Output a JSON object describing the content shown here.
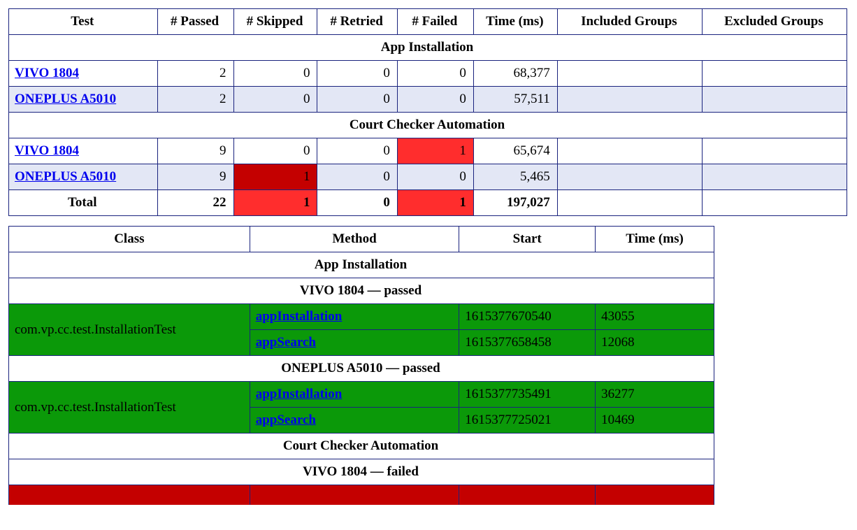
{
  "summary": {
    "headers": [
      "Test",
      "# Passed",
      "# Skipped",
      "# Retried",
      "# Failed",
      "Time (ms)",
      "Included Groups",
      "Excluded Groups"
    ],
    "sections": [
      {
        "title": "App Installation",
        "rows": [
          {
            "name": "VIVO 1804",
            "alt": false,
            "link": true,
            "cells": [
              "2",
              "0",
              "0",
              "0",
              "68,377",
              "",
              ""
            ],
            "flags": [
              null,
              null,
              null,
              null,
              null,
              null,
              null
            ]
          },
          {
            "name": "ONEPLUS A5010",
            "alt": true,
            "link": true,
            "cells": [
              "2",
              "0",
              "0",
              "0",
              "57,511",
              "",
              ""
            ],
            "flags": [
              null,
              null,
              null,
              null,
              null,
              null,
              null
            ]
          }
        ]
      },
      {
        "title": "Court Checker Automation",
        "rows": [
          {
            "name": "VIVO 1804",
            "alt": false,
            "link": true,
            "cells": [
              "9",
              "0",
              "0",
              "1",
              "65,674",
              "",
              ""
            ],
            "flags": [
              null,
              null,
              null,
              "danger2",
              null,
              null,
              null
            ]
          },
          {
            "name": "ONEPLUS A5010",
            "alt": true,
            "link": true,
            "cells": [
              "9",
              "1",
              "0",
              "0",
              "5,465",
              "",
              ""
            ],
            "flags": [
              null,
              "danger1",
              null,
              null,
              null,
              null,
              null
            ]
          }
        ]
      }
    ],
    "total": {
      "label": "Total",
      "cells": [
        "22",
        "1",
        "0",
        "1",
        "197,027",
        "",
        ""
      ],
      "flags": [
        null,
        "danger2",
        null,
        "danger2",
        null,
        null,
        null
      ]
    }
  },
  "details": {
    "headers": [
      "Class",
      "Method",
      "Start",
      "Time (ms)"
    ],
    "sections": [
      {
        "title": "App Installation",
        "devices": [
          {
            "heading": "VIVO 1804 — passed",
            "class": "com.vp.cc.test.InstallationTest",
            "rows": [
              {
                "method": "appInstallation",
                "start": "1615377670540",
                "time": "43055"
              },
              {
                "method": "appSearch",
                "start": "1615377658458",
                "time": "12068"
              }
            ]
          },
          {
            "heading": "ONEPLUS A5010 — passed",
            "class": "com.vp.cc.test.InstallationTest",
            "rows": [
              {
                "method": "appInstallation",
                "start": "1615377735491",
                "time": "36277"
              },
              {
                "method": "appSearch",
                "start": "1615377725021",
                "time": "10469"
              }
            ]
          }
        ]
      },
      {
        "title": "Court Checker Automation",
        "devices": [
          {
            "heading": "VIVO 1804 — failed",
            "class": "",
            "rows": []
          }
        ]
      }
    ]
  }
}
